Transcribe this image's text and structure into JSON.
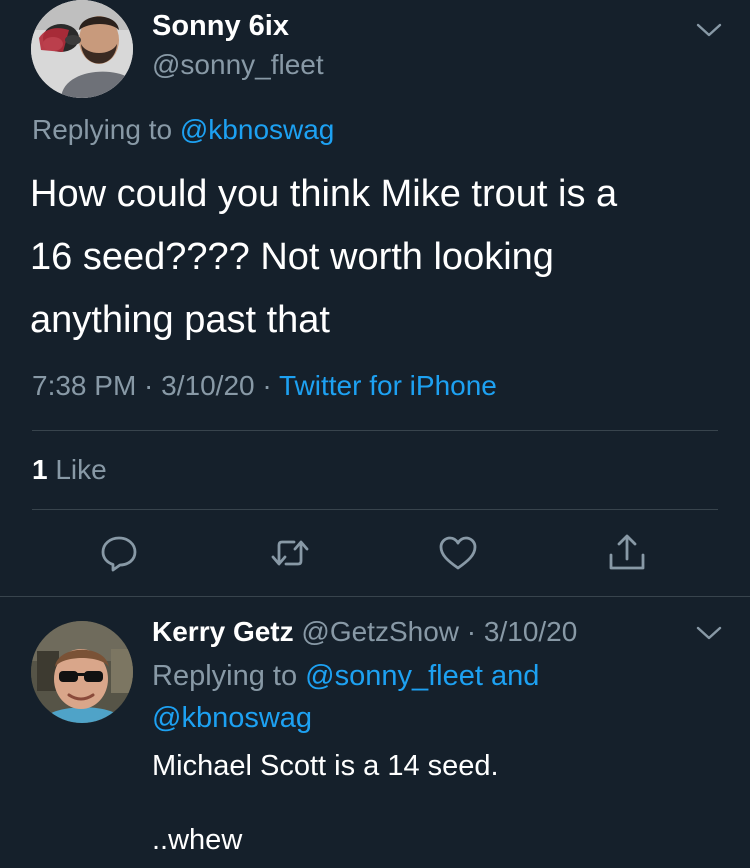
{
  "main_tweet": {
    "display_name": "Sonny 6ix",
    "handle": "@sonny_fleet",
    "replying_prefix": "Replying to ",
    "replying_to": "@kbnoswag",
    "text": "How could you think Mike trout is a\n16 seed???? Not worth looking\nanything past that",
    "time": "7:38 PM",
    "sep1": " · ",
    "date": "3/10/20",
    "sep2": " · ",
    "source": "Twitter for iPhone",
    "likes_count": "1",
    "likes_label": " Like",
    "avatar_icon": "user-avatar-photo",
    "actions": {
      "reply_icon": "reply-icon",
      "retweet_icon": "retweet-icon",
      "like_icon": "heart-icon",
      "share_icon": "share-icon"
    }
  },
  "reply_tweet": {
    "display_name": "Kerry Getz",
    "handle": "@GetzShow",
    "sep": " · ",
    "date": "3/10/20",
    "replying_prefix": "Replying to ",
    "replying_to_1": "@sonny_fleet",
    "replying_and": " and",
    "replying_to_2": "@kbnoswag",
    "text": "Michael Scott is a 14 seed.\n\n..whew"
  },
  "colors": {
    "background": "#15202b",
    "text": "#ffffff",
    "muted": "#8899a6",
    "link": "#1da1f2",
    "divider": "#38444d"
  }
}
